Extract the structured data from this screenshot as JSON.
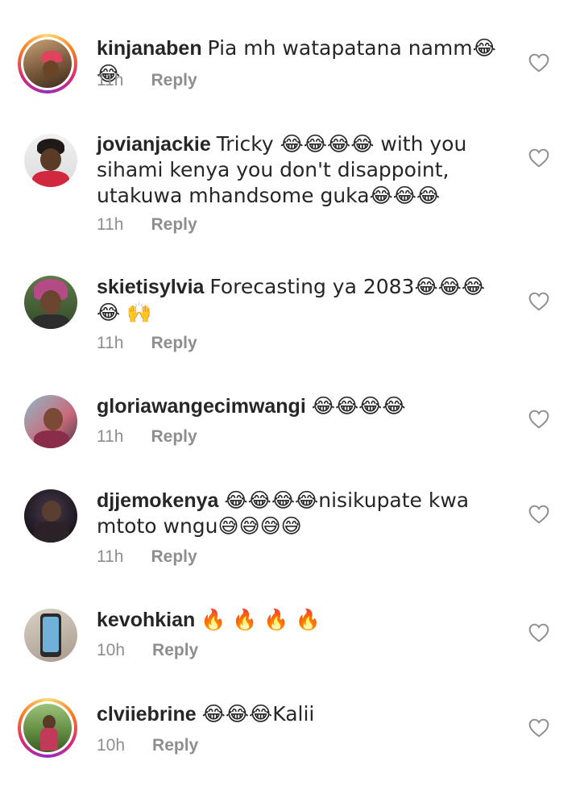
{
  "comments": [
    {
      "username": "kinjanaben",
      "text": "Pia mh watapatana namm😂😂",
      "time": "11h",
      "reply": "Reply"
    },
    {
      "username": "jovianjackie",
      "text": "Tricky 😂😂😂😂 with you sihami kenya you don't disappoint, utakuwa mhandsome guka😂😂😂",
      "time": "11h",
      "reply": "Reply"
    },
    {
      "username": "skietisylvia",
      "text": "Forecasting ya 2083😂😂😂😂 🙌",
      "time": "11h",
      "reply": "Reply"
    },
    {
      "username": "gloriawangecimwangi",
      "text": "😂😂😂😂",
      "time": "11h",
      "reply": "Reply"
    },
    {
      "username": "djjemokenya",
      "text": "😂😂😂😂nisikupate kwa mtoto wngu😅😅😅😅",
      "time": "11h",
      "reply": "Reply"
    },
    {
      "username": "kevohkian",
      "text": "🔥 🔥 🔥 🔥",
      "time": "10h",
      "reply": "Reply"
    },
    {
      "username": "clviiebrine",
      "text": "😂😂😂Kalii",
      "time": "10h",
      "reply": "Reply"
    }
  ],
  "icons": {
    "like": "heart-outline-icon"
  },
  "colors": {
    "meta": "#8e8e8e",
    "text": "#262626"
  }
}
